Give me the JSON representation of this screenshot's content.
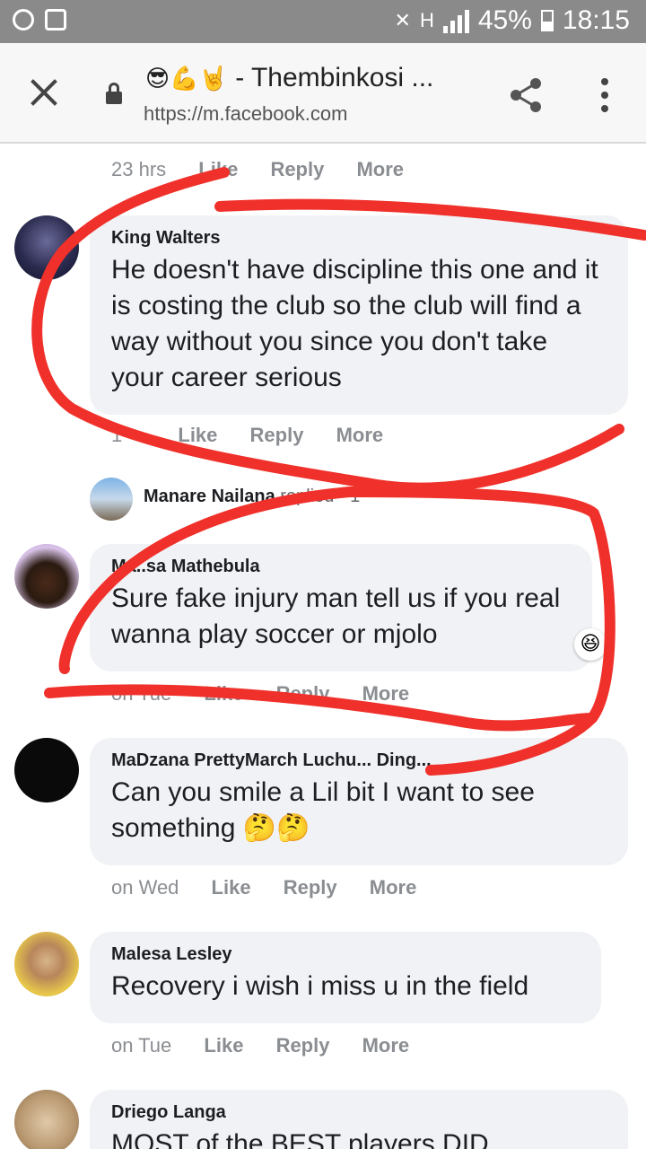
{
  "status_bar": {
    "battery": "45%",
    "time": "18:15",
    "network": "H"
  },
  "browser": {
    "title_emojis": "😎💪🤘",
    "title": " - Thembinkosi ...",
    "url": "https://m.facebook.com"
  },
  "actions": {
    "like": "Like",
    "reply": "Reply",
    "more": "More"
  },
  "top_meta": {
    "time": "23 hrs"
  },
  "comments": [
    {
      "name": "King Walters",
      "text": "He doesn't have discipline this one and it is costing the club so the club will find a way without you since you don't take your career serious",
      "time": "1"
    },
    {
      "name": "Ma..sa Mathebula",
      "text": "Sure fake injury man tell us if you real wanna play soccer or mjolo",
      "time": "on Tue",
      "reaction": "😆"
    },
    {
      "name": "MaDzana PrettyMarch Luchu... Ding...",
      "text": "Can you smile a Lil bit I want to see something 🤔🤔",
      "time": "on Wed"
    },
    {
      "name": "Malesa Lesley",
      "text": "Recovery i wish i miss u in the field",
      "time": "on Tue"
    },
    {
      "name": "Driego Langa",
      "text": "MOST of the BEST players DID",
      "time": ""
    }
  ],
  "reply_preview": {
    "name": "Manare Nailana",
    "suffix": " replied · 1"
  },
  "colors": {
    "scribble": "#f0302a",
    "bubble": "#f0f2f5",
    "status_bar": "#8a8a8a"
  }
}
